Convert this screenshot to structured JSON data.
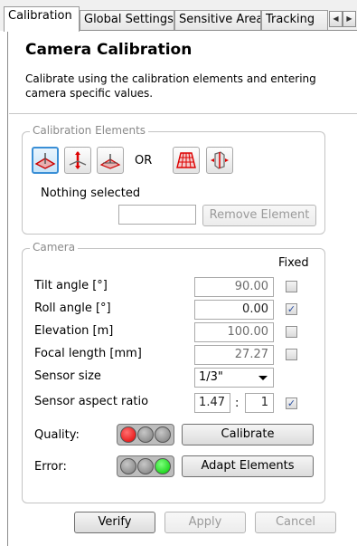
{
  "tabs": [
    "Calibration",
    "Global Settings",
    "Sensitive Area",
    "Tracking"
  ],
  "active_tab": "Calibration",
  "header": {
    "title": "Camera Calibration",
    "description": "Calibrate using the calibration elements and entering camera specific values."
  },
  "calibration_elements": {
    "group_label": "Calibration Elements",
    "or_label": "OR",
    "icons": [
      "horizontal-plane-icon",
      "vertical-pole-icon",
      "angle-plane-icon",
      "grid-area-icon",
      "vertical-box-icon"
    ],
    "selection_status": "Nothing selected",
    "remove_button": "Remove Element"
  },
  "camera": {
    "group_label": "Camera",
    "fixed_header": "Fixed",
    "rows": [
      {
        "label": "Tilt angle [°]",
        "value": "90.00",
        "fixed": false
      },
      {
        "label": "Roll angle [°]",
        "value": "0.00",
        "fixed": true
      },
      {
        "label": "Elevation [m]",
        "value": "100.00",
        "fixed": false
      },
      {
        "label": "Focal length [mm]",
        "value": "27.27",
        "fixed": false
      }
    ],
    "sensor_size_label": "Sensor size",
    "sensor_size_value": "1/3\"",
    "aspect_label": "Sensor aspect ratio",
    "aspect_width": "1.47",
    "aspect_sep": ":",
    "aspect_height": "1",
    "aspect_fixed": true,
    "quality_label": "Quality:",
    "quality_indicators": [
      "red",
      "grey",
      "grey"
    ],
    "calibrate_button": "Calibrate",
    "error_label": "Error:",
    "error_indicators": [
      "grey",
      "grey",
      "green"
    ],
    "adapt_button": "Adapt Elements"
  },
  "footer": {
    "verify": "Verify",
    "apply": "Apply",
    "cancel": "Cancel"
  },
  "colors": {
    "selected_border": "#3a8fd6",
    "icon_red": "#e0202a"
  }
}
